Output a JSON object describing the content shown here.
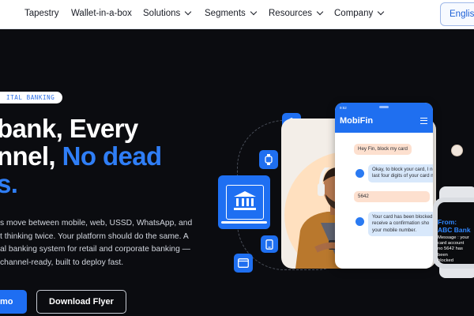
{
  "nav": {
    "items": [
      {
        "label": "Tapestry",
        "dropdown": false
      },
      {
        "label": "Wallet-in-a-box",
        "dropdown": false
      },
      {
        "label": "Solutions",
        "dropdown": true
      },
      {
        "label": "Segments",
        "dropdown": true
      },
      {
        "label": "Resources",
        "dropdown": true
      },
      {
        "label": "Company",
        "dropdown": true
      }
    ],
    "language": "English"
  },
  "hero": {
    "badge": "ITAL BANKING",
    "headline_line1": "bank, Every",
    "headline_line2_white": "nnel,",
    "headline_line2_blue": "No dead",
    "headline_line3": "s.",
    "description_lines": [
      "s move between mobile, web, USSD, WhatsApp, and",
      "t thinking twice. Your platform should do the same. A",
      "al banking system for retail and corporate banking —",
      "channel-ready, built to deploy fast."
    ],
    "demo_button": "mo",
    "flyer_button": "Download Flyer"
  },
  "phone": {
    "status": "9:52",
    "app_name": "MobiFin",
    "messages": [
      "Hey Fin, block my card",
      "Okay, to block your card, I need the|last four digits of your card number.",
      "5642",
      "Your card has been blocked|receive a confirmation sho|your mobile number."
    ]
  },
  "watch": {
    "from": "From:|ABC Bank",
    "message": "Message : your|card account|no 5642 has been|blocked"
  },
  "colors": {
    "accent": "#1f6ff0",
    "background": "#0b0c10",
    "headline_blue": "#2f7ef6"
  }
}
